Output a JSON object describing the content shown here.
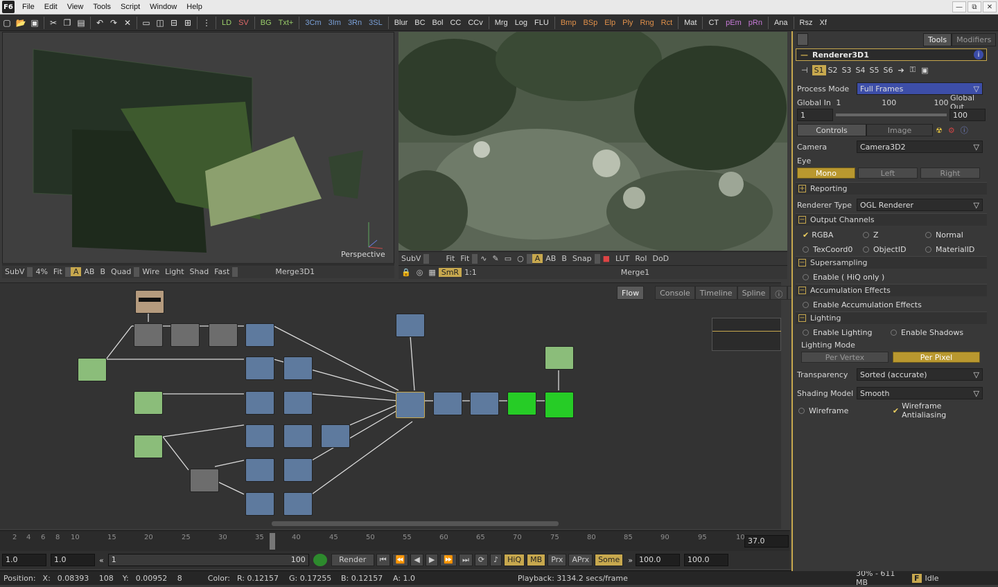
{
  "menubar": {
    "logo": "F6",
    "items": [
      "File",
      "Edit",
      "View",
      "Tools",
      "Script",
      "Window",
      "Help"
    ],
    "win_buttons": [
      "—",
      "⧉",
      "✕"
    ]
  },
  "toolbar": {
    "tools": [
      {
        "label": "LD",
        "color": "#9acd6a"
      },
      {
        "label": "SV",
        "color": "#e06a6a"
      },
      {
        "label": "BG",
        "color": "#9acd6a"
      },
      {
        "label": "Txt+",
        "color": "#9acd6a"
      },
      {
        "label": "3Cm",
        "color": "#7aa0d8"
      },
      {
        "label": "3Im",
        "color": "#7aa0d8"
      },
      {
        "label": "3Rn",
        "color": "#7aa0d8"
      },
      {
        "label": "3SL",
        "color": "#7aa0d8"
      },
      {
        "label": "Blur",
        "color": "#e0e0e0"
      },
      {
        "label": "BC",
        "color": "#e0e0e0"
      },
      {
        "label": "Bol",
        "color": "#e0e0e0"
      },
      {
        "label": "CC",
        "color": "#e0e0e0"
      },
      {
        "label": "CCv",
        "color": "#e0e0e0"
      },
      {
        "label": "Mrg",
        "color": "#e0e0e0"
      },
      {
        "label": "Log",
        "color": "#e0e0e0"
      },
      {
        "label": "FLU",
        "color": "#e0e0e0"
      },
      {
        "label": "Bmp",
        "color": "#e0904a"
      },
      {
        "label": "BSp",
        "color": "#e0904a"
      },
      {
        "label": "Elp",
        "color": "#e0904a"
      },
      {
        "label": "Ply",
        "color": "#e0904a"
      },
      {
        "label": "Rng",
        "color": "#e0904a"
      },
      {
        "label": "Rct",
        "color": "#e0904a"
      },
      {
        "label": "Mat",
        "color": "#e0e0e0"
      },
      {
        "label": "CT",
        "color": "#e0e0e0"
      },
      {
        "label": "pEm",
        "color": "#c77ad8"
      },
      {
        "label": "pRn",
        "color": "#c77ad8"
      },
      {
        "label": "Ana",
        "color": "#e0e0e0"
      },
      {
        "label": "Rsz",
        "color": "#e0e0e0"
      },
      {
        "label": "Xf",
        "color": "#e0e0e0"
      }
    ]
  },
  "viewer1": {
    "axis_label": "Perspective",
    "bar": {
      "subv": "SubV",
      "zoom": "4%",
      "fit": "Fit",
      "a": "A",
      "ab": "AB",
      "b": "B",
      "quad": "Quad",
      "wire": "Wire",
      "light": "Light",
      "shad": "Shad",
      "fast": "Fast",
      "node": "Merge3D1"
    }
  },
  "viewer2": {
    "bar1": {
      "subv": "SubV",
      "fit1": "Fit",
      "fit2": "Fit",
      "a": "A",
      "ab": "AB",
      "b": "B",
      "snap": "Snap",
      "lut": "LUT",
      "roi": "RoI",
      "dod": "DoD"
    },
    "bar2": {
      "smr": "SmR",
      "ratio": "1:1",
      "node": "Merge1"
    }
  },
  "flow": {
    "tabs": [
      "Flow",
      "Console",
      "Timeline",
      "Spline"
    ]
  },
  "timeline": {
    "ticks": [
      "2",
      "4",
      "6",
      "8",
      "10",
      "15",
      "20",
      "25",
      "30",
      "35",
      "40",
      "45",
      "50",
      "55",
      "60",
      "65",
      "70",
      "75",
      "80",
      "85",
      "90",
      "95",
      "10"
    ],
    "current": "37.0"
  },
  "transport": {
    "start": "1.0",
    "range_start": "1.0",
    "range_value": "1",
    "range_end": "100",
    "render": "Render",
    "hiq": "HiQ",
    "mb": "MB",
    "prx": "Prx",
    "aprx": "APrx",
    "some": "Some",
    "end1": "100.0",
    "end2": "100.0"
  },
  "status": {
    "position_label": "Position:",
    "x_label": "X:",
    "x_val": "0.08393",
    "x_px": "108",
    "y_label": "Y:",
    "y_val": "0.00952",
    "y_px": "8",
    "color_label": "Color:",
    "r": "R: 0.12157",
    "g": "G: 0.17255",
    "b": "B: 0.12157",
    "a": "A: 1.0",
    "playback": "Playback: 3134.2 secs/frame",
    "mem": "30% - 611 MB",
    "state": "Idle"
  },
  "panel": {
    "tabs": [
      "Tools",
      "Modifiers"
    ],
    "tool_name": "Renderer3D1",
    "slots": [
      "S1",
      "S2",
      "S3",
      "S4",
      "S5",
      "S6"
    ],
    "process_mode_label": "Process Mode",
    "process_mode": "Full Frames",
    "global_in_label": "Global In",
    "global_out_label": "Global Out",
    "gin_min": "1",
    "gin_mid": "100",
    "gin_max": "100",
    "gin_val": "1",
    "gout_val": "100",
    "subtabs": [
      "Controls",
      "Image"
    ],
    "camera_label": "Camera",
    "camera": "Camera3D2",
    "eye_label": "Eye",
    "eye": [
      "Mono",
      "Left",
      "Right"
    ],
    "reporting": "Reporting",
    "renderer_type_label": "Renderer Type",
    "renderer_type": "OGL Renderer",
    "output_channels": "Output Channels",
    "channels": [
      "RGBA",
      "Z",
      "Normal",
      "TexCoord0",
      "ObjectID",
      "MaterialID"
    ],
    "supersampling": "Supersampling",
    "enable_hiq": "Enable ( HiQ only )",
    "accumulation": "Accumulation Effects",
    "enable_accumulation": "Enable Accumulation Effects",
    "lighting": "Lighting",
    "enable_lighting": "Enable Lighting",
    "enable_shadows": "Enable Shadows",
    "lighting_mode_label": "Lighting Mode",
    "lighting_modes": [
      "Per Vertex",
      "Per Pixel"
    ],
    "transparency_label": "Transparency",
    "transparency": "Sorted (accurate)",
    "shading_label": "Shading Model",
    "shading": "Smooth",
    "wireframe": "Wireframe",
    "wireframe_aa": "Wireframe Antialiasing"
  }
}
